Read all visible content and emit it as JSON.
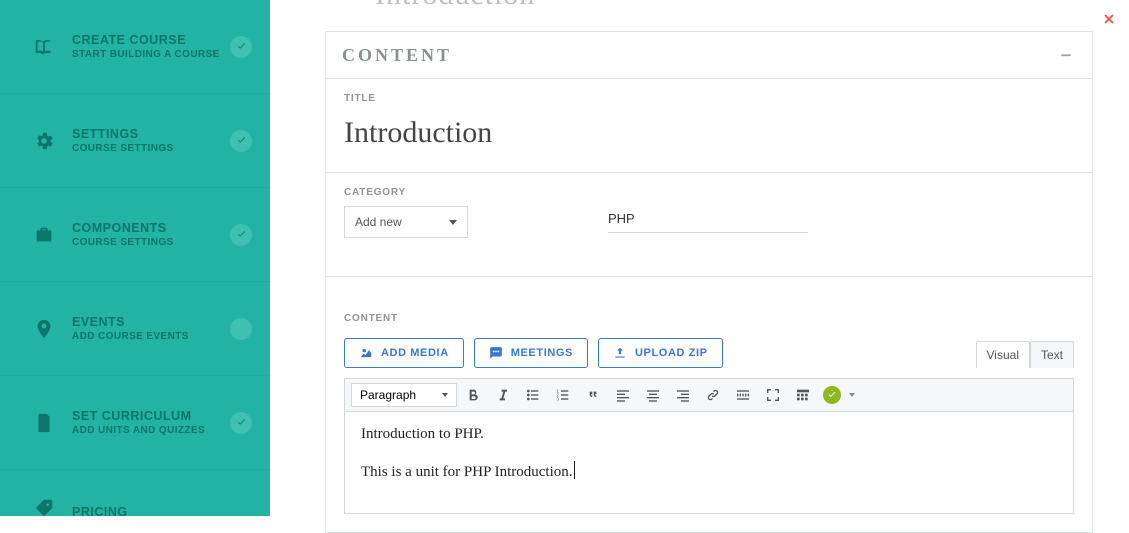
{
  "sidebar": {
    "items": [
      {
        "title": "CREATE COURSE",
        "sub": "START BUILDING A COURSE",
        "checked": true
      },
      {
        "title": "SETTINGS",
        "sub": "COURSE SETTINGS",
        "checked": true
      },
      {
        "title": "COMPONENTS",
        "sub": "COURSE SETTINGS",
        "checked": true
      },
      {
        "title": "EVENTS",
        "sub": "ADD COURSE EVENTS",
        "checked": false
      },
      {
        "title": "SET CURRICULUM",
        "sub": "ADD UNITS AND QUIZZES",
        "checked": true
      },
      {
        "title": "PRICING",
        "sub": "",
        "checked": false
      }
    ]
  },
  "ghost_heading": "Introduction",
  "panel": {
    "heading": "CONTENT",
    "title_label": "TITLE",
    "title_value": "Introduction",
    "category_label": "CATEGORY",
    "category_select": "Add new",
    "category_value": "PHP",
    "content_label": "CONTENT",
    "buttons": {
      "add_media": "ADD MEDIA",
      "meetings": "MEETINGS",
      "upload_zip": "UPLOAD ZIP"
    },
    "tabs": {
      "visual": "Visual",
      "text": "Text"
    },
    "format_select": "Paragraph",
    "body_lines": [
      "Introduction to PHP.",
      "This is a unit for PHP Introduction."
    ]
  }
}
